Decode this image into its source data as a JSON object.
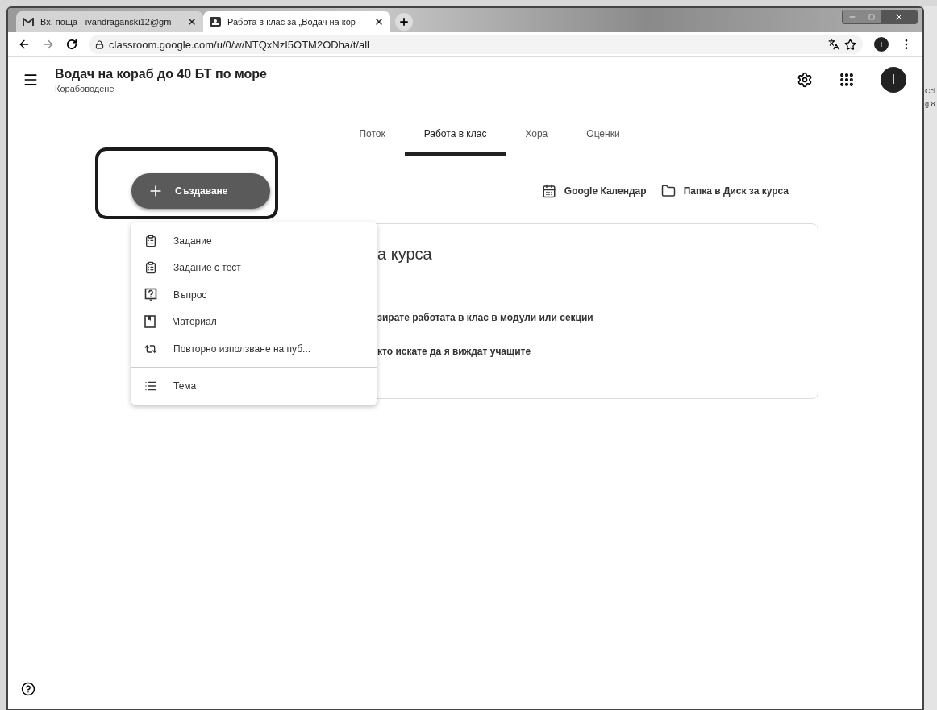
{
  "browser": {
    "tabs": [
      {
        "title": "Вх. поща - ivandraganski12@gm",
        "selected": false,
        "kind": "mail"
      },
      {
        "title": "Работа в клас за „Водач на кор",
        "selected": true,
        "kind": "classroom"
      }
    ],
    "url": "classroom.google.com/u/0/w/NTQxNzI5OTM2ODha/t/all",
    "profile_initial": "I"
  },
  "header": {
    "title": "Водач на кораб до 40 БТ по море",
    "subtitle": "Корабоводене",
    "avatar_initial": "I"
  },
  "nav_tabs": [
    {
      "label": "Поток",
      "selected": false
    },
    {
      "label": "Работа в клас",
      "selected": true
    },
    {
      "label": "Хора",
      "selected": false
    },
    {
      "label": "Оценки",
      "selected": false
    }
  ],
  "create_button": {
    "label": "Създаване"
  },
  "links": [
    {
      "label": "Google Календар",
      "kind": "calendar"
    },
    {
      "label": "Папка в Диск за курса",
      "kind": "folder"
    }
  ],
  "create_menu": {
    "items": [
      {
        "label": "Задание",
        "kind": "assignment"
      },
      {
        "label": "Задание с тест",
        "kind": "quiz"
      },
      {
        "label": "Въпрос",
        "kind": "question"
      },
      {
        "label": "Материал",
        "kind": "material"
      },
      {
        "label": "Повторно използване на пуб...",
        "kind": "reuse"
      },
      {
        "label": "Тема",
        "kind": "topic"
      }
    ]
  },
  "card": {
    "title": "а курса",
    "lines": [
      "зирате работата в клас в модули или секции",
      "кто искате да я виждат учащите"
    ]
  },
  "edge_texts": [
    "Ccl",
    "g 8"
  ]
}
